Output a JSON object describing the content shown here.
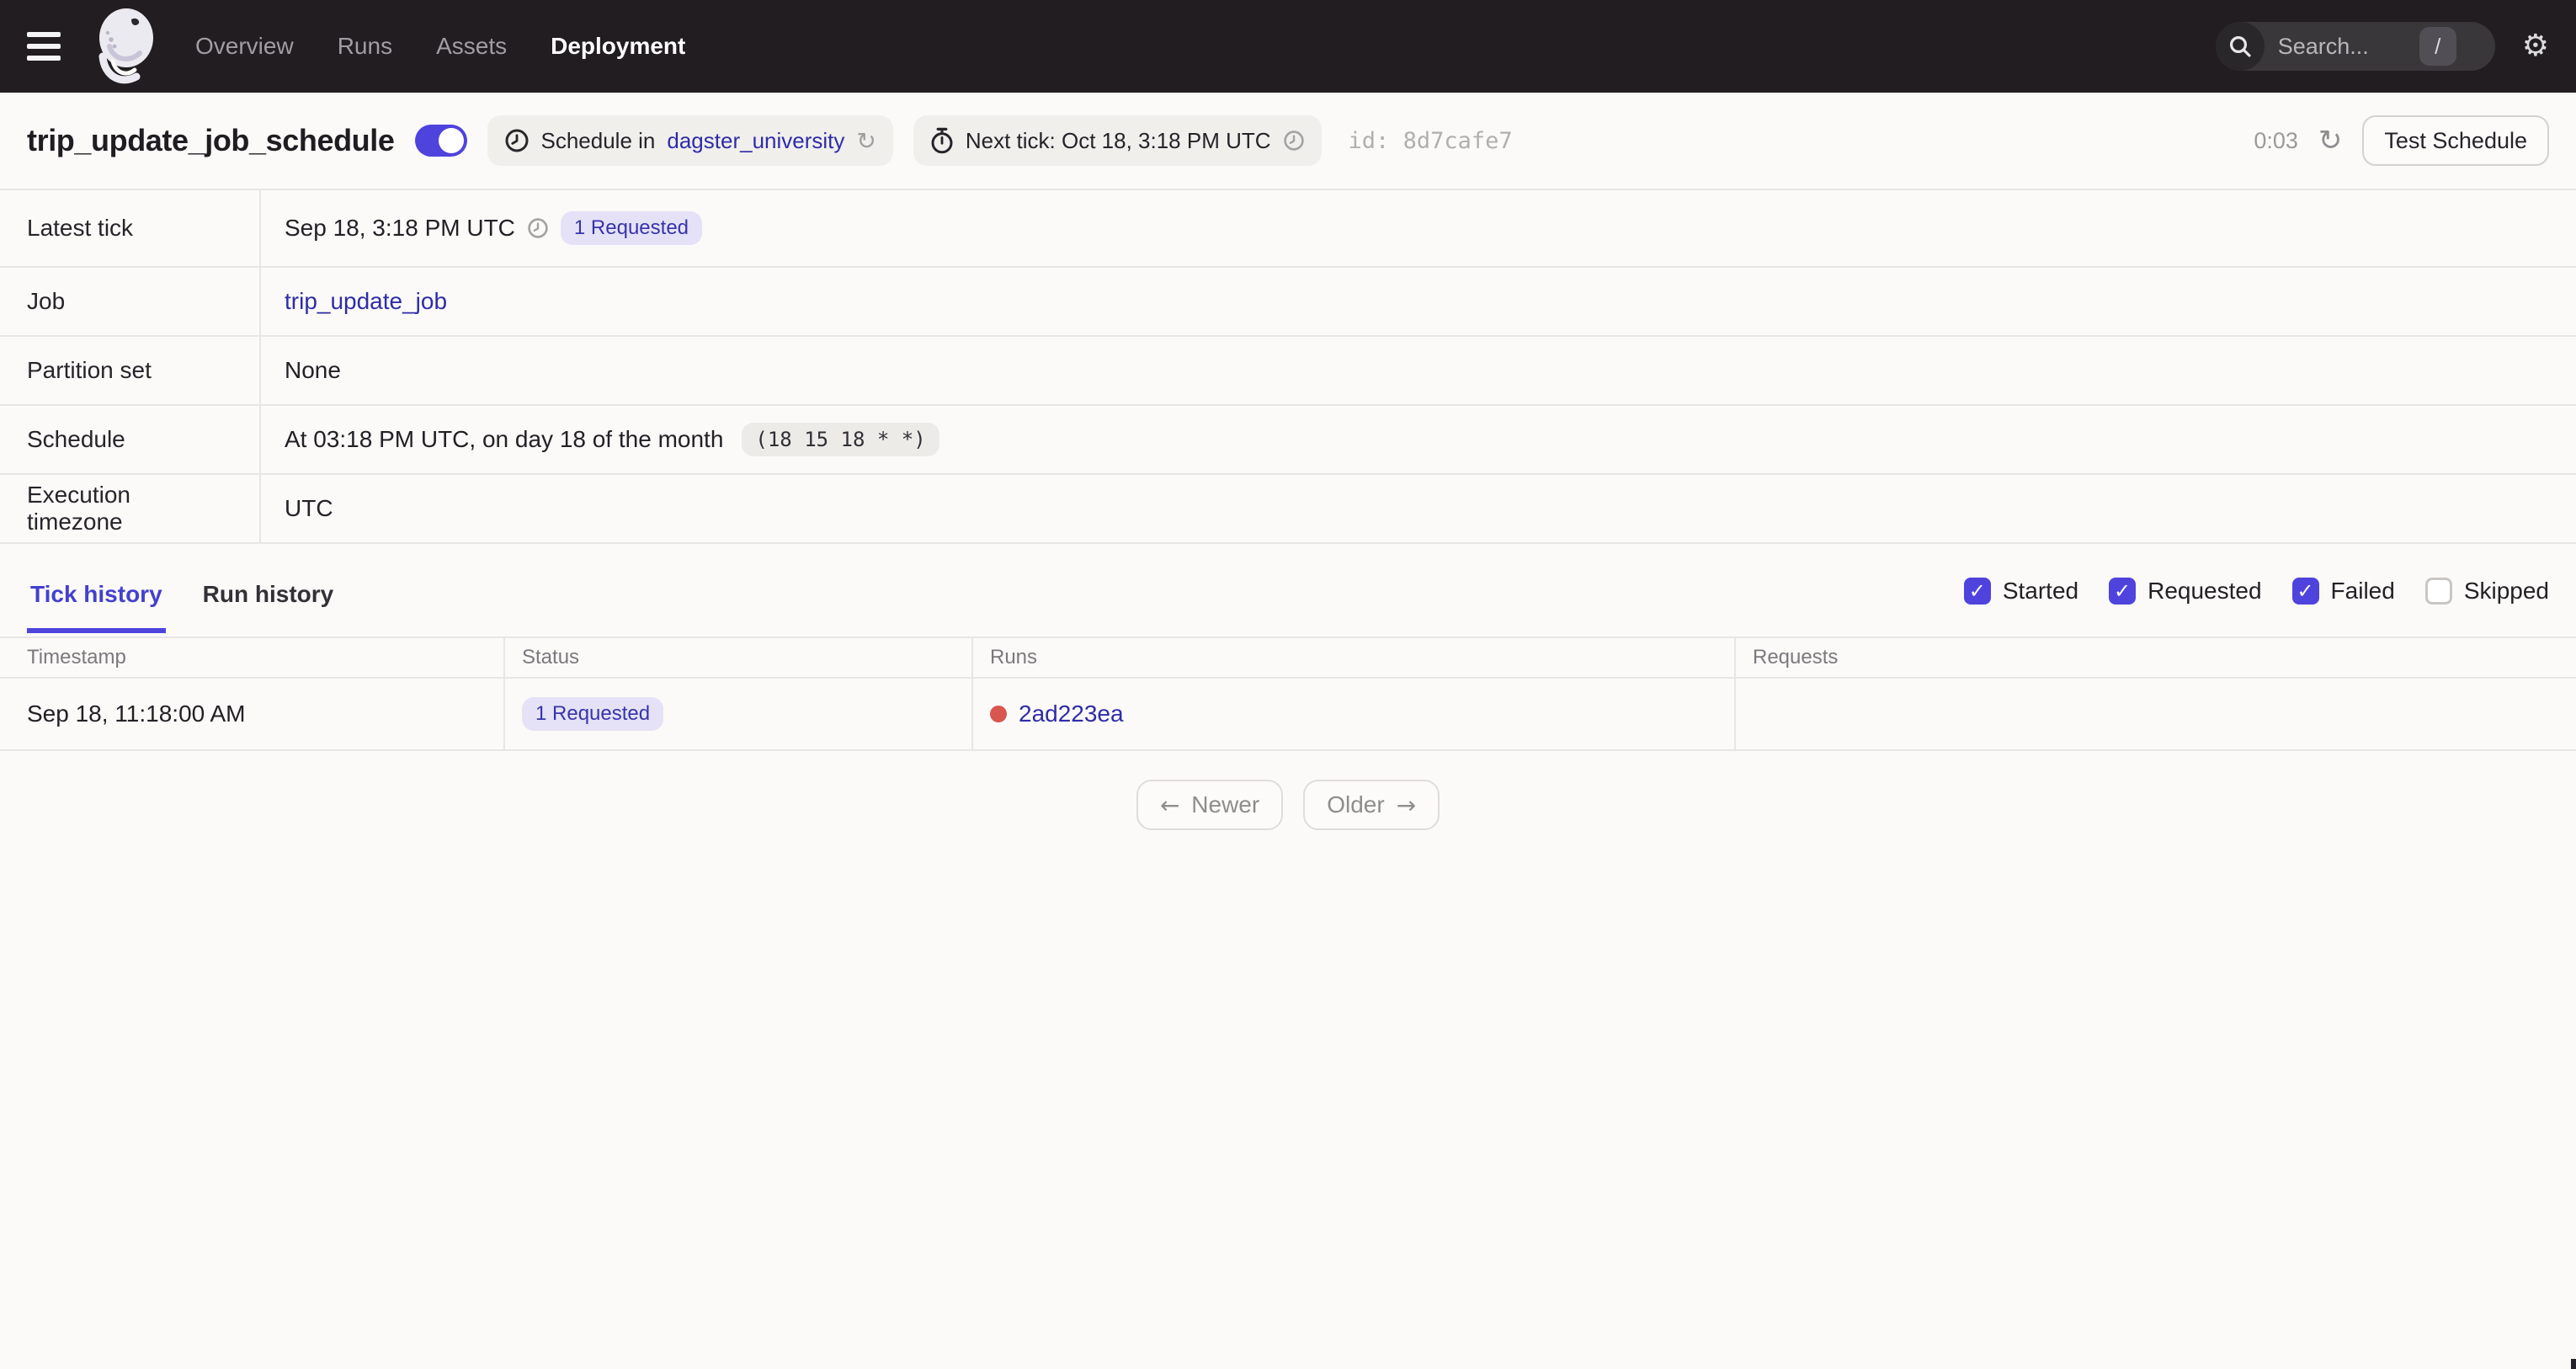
{
  "nav": {
    "items": [
      {
        "label": "Overview",
        "active": false
      },
      {
        "label": "Runs",
        "active": false
      },
      {
        "label": "Assets",
        "active": false
      },
      {
        "label": "Deployment",
        "active": true
      }
    ]
  },
  "search": {
    "placeholder": "Search...",
    "shortcut_key": "/"
  },
  "icons": {
    "gear": "⚙",
    "refresh": "↻",
    "arrow_left": "←",
    "arrow_right": "→",
    "check": "✓"
  },
  "header": {
    "title": "trip_update_job_schedule",
    "toggle_state": "on",
    "context_pill": {
      "prefix": "Schedule in",
      "repo_link": "dagster_university"
    },
    "next_tick_pill": "Next tick: Oct 18, 3:18 PM UTC",
    "id_label": "id:",
    "id_value": "8d7cafe7",
    "refresh_countdown": "0:03",
    "test_schedule_button": "Test Schedule"
  },
  "details": {
    "rows": [
      {
        "label": "Latest tick",
        "time": "Sep 18, 3:18 PM UTC",
        "badge": "1 Requested"
      },
      {
        "label": "Job",
        "link": "trip_update_job"
      },
      {
        "label": "Partition set",
        "value": "None"
      },
      {
        "label": "Schedule",
        "value": "At 03:18 PM UTC, on day 18 of the month",
        "cron": "(18 15 18 * *)"
      },
      {
        "label": "Execution timezone",
        "value": "UTC"
      }
    ]
  },
  "tabs": [
    {
      "label": "Tick history",
      "active": true
    },
    {
      "label": "Run history",
      "active": false
    }
  ],
  "filters": [
    {
      "label": "Started",
      "checked": true
    },
    {
      "label": "Requested",
      "checked": true
    },
    {
      "label": "Failed",
      "checked": true
    },
    {
      "label": "Skipped",
      "checked": false
    }
  ],
  "tick_table": {
    "headers": [
      "Timestamp",
      "Status",
      "Runs",
      "Requests"
    ],
    "rows": [
      {
        "timestamp": "Sep 18, 11:18:00 AM",
        "status": "1 Requested",
        "run_id": "2ad223ea",
        "requests": ""
      }
    ]
  },
  "pagination": {
    "newer": "Newer",
    "older": "Older"
  },
  "colors": {
    "accent": "#4F43DD",
    "link": "#2E2CA8",
    "nav_background": "#211D20",
    "failed_dot": "#D9564F",
    "badge_background": "#E5E2F8",
    "badge_text": "#3734AB"
  }
}
